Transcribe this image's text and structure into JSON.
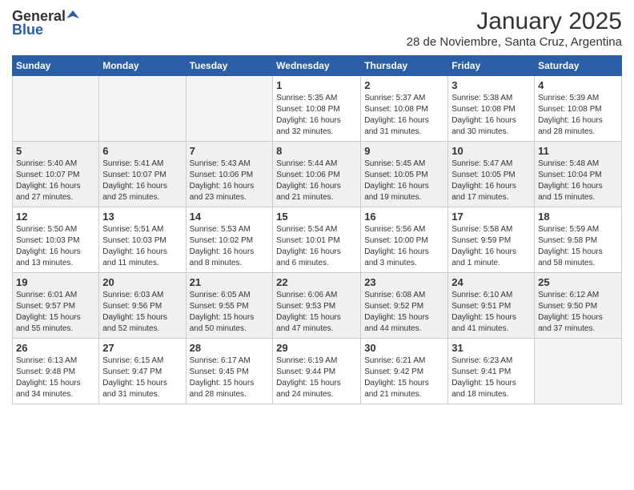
{
  "logo": {
    "general": "General",
    "blue": "Blue"
  },
  "header": {
    "title": "January 2025",
    "subtitle": "28 de Noviembre, Santa Cruz, Argentina"
  },
  "weekdays": [
    "Sunday",
    "Monday",
    "Tuesday",
    "Wednesday",
    "Thursday",
    "Friday",
    "Saturday"
  ],
  "weeks": [
    [
      {
        "day": "",
        "info": ""
      },
      {
        "day": "",
        "info": ""
      },
      {
        "day": "",
        "info": ""
      },
      {
        "day": "1",
        "info": "Sunrise: 5:35 AM\nSunset: 10:08 PM\nDaylight: 16 hours\nand 32 minutes."
      },
      {
        "day": "2",
        "info": "Sunrise: 5:37 AM\nSunset: 10:08 PM\nDaylight: 16 hours\nand 31 minutes."
      },
      {
        "day": "3",
        "info": "Sunrise: 5:38 AM\nSunset: 10:08 PM\nDaylight: 16 hours\nand 30 minutes."
      },
      {
        "day": "4",
        "info": "Sunrise: 5:39 AM\nSunset: 10:08 PM\nDaylight: 16 hours\nand 28 minutes."
      }
    ],
    [
      {
        "day": "5",
        "info": "Sunrise: 5:40 AM\nSunset: 10:07 PM\nDaylight: 16 hours\nand 27 minutes."
      },
      {
        "day": "6",
        "info": "Sunrise: 5:41 AM\nSunset: 10:07 PM\nDaylight: 16 hours\nand 25 minutes."
      },
      {
        "day": "7",
        "info": "Sunrise: 5:43 AM\nSunset: 10:06 PM\nDaylight: 16 hours\nand 23 minutes."
      },
      {
        "day": "8",
        "info": "Sunrise: 5:44 AM\nSunset: 10:06 PM\nDaylight: 16 hours\nand 21 minutes."
      },
      {
        "day": "9",
        "info": "Sunrise: 5:45 AM\nSunset: 10:05 PM\nDaylight: 16 hours\nand 19 minutes."
      },
      {
        "day": "10",
        "info": "Sunrise: 5:47 AM\nSunset: 10:05 PM\nDaylight: 16 hours\nand 17 minutes."
      },
      {
        "day": "11",
        "info": "Sunrise: 5:48 AM\nSunset: 10:04 PM\nDaylight: 16 hours\nand 15 minutes."
      }
    ],
    [
      {
        "day": "12",
        "info": "Sunrise: 5:50 AM\nSunset: 10:03 PM\nDaylight: 16 hours\nand 13 minutes."
      },
      {
        "day": "13",
        "info": "Sunrise: 5:51 AM\nSunset: 10:03 PM\nDaylight: 16 hours\nand 11 minutes."
      },
      {
        "day": "14",
        "info": "Sunrise: 5:53 AM\nSunset: 10:02 PM\nDaylight: 16 hours\nand 8 minutes."
      },
      {
        "day": "15",
        "info": "Sunrise: 5:54 AM\nSunset: 10:01 PM\nDaylight: 16 hours\nand 6 minutes."
      },
      {
        "day": "16",
        "info": "Sunrise: 5:56 AM\nSunset: 10:00 PM\nDaylight: 16 hours\nand 3 minutes."
      },
      {
        "day": "17",
        "info": "Sunrise: 5:58 AM\nSunset: 9:59 PM\nDaylight: 16 hours\nand 1 minute."
      },
      {
        "day": "18",
        "info": "Sunrise: 5:59 AM\nSunset: 9:58 PM\nDaylight: 15 hours\nand 58 minutes."
      }
    ],
    [
      {
        "day": "19",
        "info": "Sunrise: 6:01 AM\nSunset: 9:57 PM\nDaylight: 15 hours\nand 55 minutes."
      },
      {
        "day": "20",
        "info": "Sunrise: 6:03 AM\nSunset: 9:56 PM\nDaylight: 15 hours\nand 52 minutes."
      },
      {
        "day": "21",
        "info": "Sunrise: 6:05 AM\nSunset: 9:55 PM\nDaylight: 15 hours\nand 50 minutes."
      },
      {
        "day": "22",
        "info": "Sunrise: 6:06 AM\nSunset: 9:53 PM\nDaylight: 15 hours\nand 47 minutes."
      },
      {
        "day": "23",
        "info": "Sunrise: 6:08 AM\nSunset: 9:52 PM\nDaylight: 15 hours\nand 44 minutes."
      },
      {
        "day": "24",
        "info": "Sunrise: 6:10 AM\nSunset: 9:51 PM\nDaylight: 15 hours\nand 41 minutes."
      },
      {
        "day": "25",
        "info": "Sunrise: 6:12 AM\nSunset: 9:50 PM\nDaylight: 15 hours\nand 37 minutes."
      }
    ],
    [
      {
        "day": "26",
        "info": "Sunrise: 6:13 AM\nSunset: 9:48 PM\nDaylight: 15 hours\nand 34 minutes."
      },
      {
        "day": "27",
        "info": "Sunrise: 6:15 AM\nSunset: 9:47 PM\nDaylight: 15 hours\nand 31 minutes."
      },
      {
        "day": "28",
        "info": "Sunrise: 6:17 AM\nSunset: 9:45 PM\nDaylight: 15 hours\nand 28 minutes."
      },
      {
        "day": "29",
        "info": "Sunrise: 6:19 AM\nSunset: 9:44 PM\nDaylight: 15 hours\nand 24 minutes."
      },
      {
        "day": "30",
        "info": "Sunrise: 6:21 AM\nSunset: 9:42 PM\nDaylight: 15 hours\nand 21 minutes."
      },
      {
        "day": "31",
        "info": "Sunrise: 6:23 AM\nSunset: 9:41 PM\nDaylight: 15 hours\nand 18 minutes."
      },
      {
        "day": "",
        "info": ""
      }
    ]
  ]
}
